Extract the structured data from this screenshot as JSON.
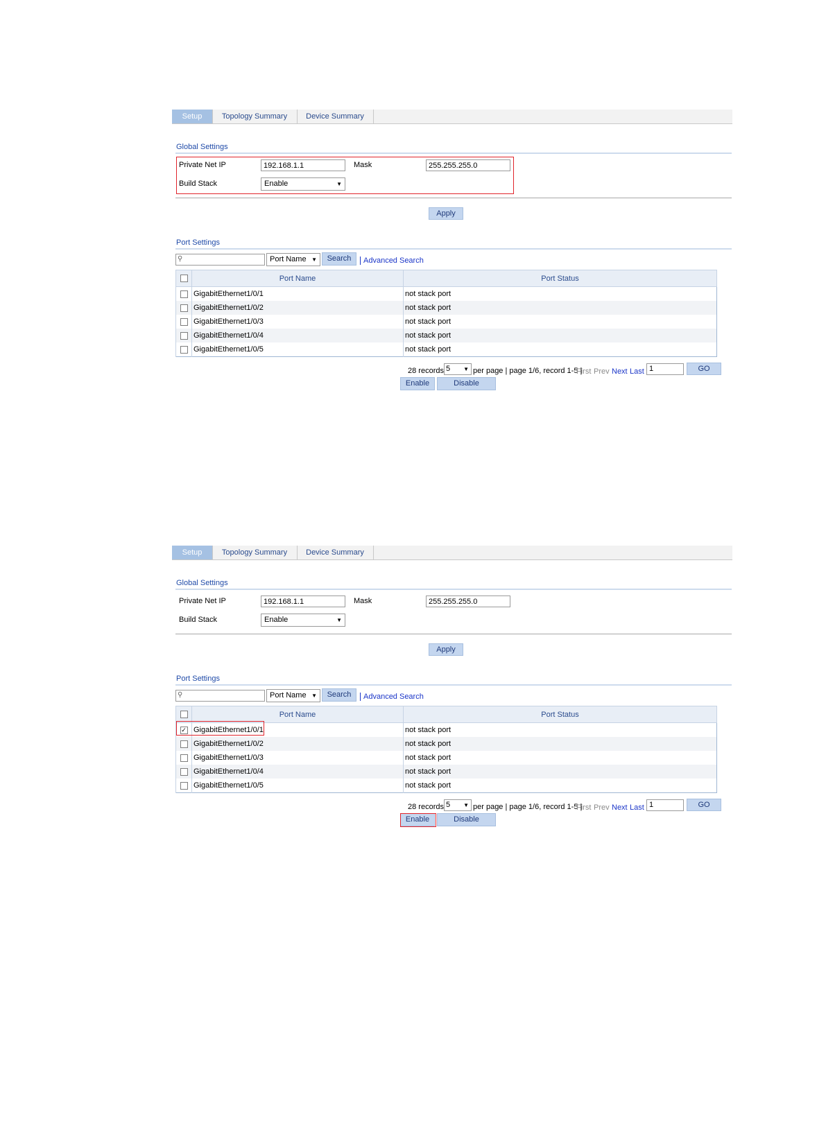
{
  "tabs": [
    "Setup",
    "Topology Summary",
    "Device Summary"
  ],
  "global_settings": {
    "title": "Global Settings",
    "private_net_ip_label": "Private Net IP",
    "private_net_ip_value": "192.168.1.1",
    "mask_label": "Mask",
    "mask_value": "255.255.255.0",
    "build_stack_label": "Build Stack",
    "build_stack_value": "Enable",
    "apply_label": "Apply"
  },
  "port_settings": {
    "title": "Port Settings",
    "search_field_value": "Port Name",
    "search_label": "Search",
    "advanced_search_label": "Advanced Search",
    "columns": [
      "Port Name",
      "Port Status"
    ],
    "rows": [
      {
        "name": "GigabitEthernet1/0/1",
        "status": "not stack port"
      },
      {
        "name": "GigabitEthernet1/0/2",
        "status": "not stack port"
      },
      {
        "name": "GigabitEthernet1/0/3",
        "status": "not stack port"
      },
      {
        "name": "GigabitEthernet1/0/4",
        "status": "not stack port"
      },
      {
        "name": "GigabitEthernet1/0/5",
        "status": "not stack port"
      }
    ],
    "pager": {
      "records_text": "28 records,",
      "per_page_value": "5",
      "per_page_text": "per page | page 1/6, record 1-5 |",
      "first": "First",
      "prev": "Prev",
      "next": "Next",
      "last": "Last",
      "page_input": "1",
      "go_label": "GO"
    },
    "enable_label": "Enable",
    "disable_label": "Disable"
  },
  "screens": [
    {
      "checked_rows": [],
      "highlight": "global-settings"
    },
    {
      "checked_rows": [
        0
      ],
      "highlight": "row-and-enable"
    }
  ]
}
